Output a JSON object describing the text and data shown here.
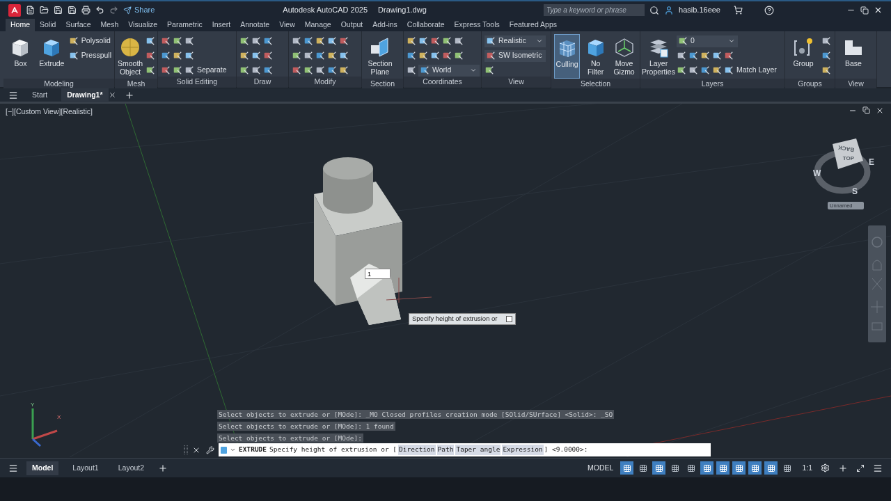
{
  "title_bar": {
    "share": "Share",
    "title": "Autodesk AutoCAD 2025",
    "file": "Drawing1.dwg",
    "search": {
      "placeholder": "Type a keyword or phrase"
    },
    "user": "hasib.16eee"
  },
  "ribbon_tabs": [
    {
      "label": "Home",
      "selected": true
    },
    {
      "label": "Solid",
      "selected": false
    },
    {
      "label": "Surface",
      "selected": false
    },
    {
      "label": "Mesh",
      "selected": false
    },
    {
      "label": "Visualize",
      "selected": false
    },
    {
      "label": "Parametric",
      "selected": false
    },
    {
      "label": "Insert",
      "selected": false
    },
    {
      "label": "Annotate",
      "selected": false
    },
    {
      "label": "View",
      "selected": false
    },
    {
      "label": "Manage",
      "selected": false
    },
    {
      "label": "Output",
      "selected": false
    },
    {
      "label": "Add-ins",
      "selected": false
    },
    {
      "label": "Collaborate",
      "selected": false
    },
    {
      "label": "Express Tools",
      "selected": false
    },
    {
      "label": "Featured Apps",
      "selected": false
    }
  ],
  "ribbon_panels": [
    {
      "title": "Modeling",
      "large": [
        {
          "label": "Box",
          "selected": false
        },
        {
          "label": "Extrude",
          "selected": false
        }
      ],
      "rows": [
        [
          {
            "kind": "small",
            "label": "Polysolid"
          }
        ],
        [
          {
            "kind": "small",
            "label": "Presspull"
          }
        ]
      ]
    },
    {
      "title": "Mesh",
      "large": [
        {
          "label": "Smooth Object",
          "selected": false
        }
      ],
      "rows": [
        [
          {
            "kind": "icon"
          }
        ],
        [
          {
            "kind": "icon"
          }
        ],
        [
          {
            "kind": "icon"
          }
        ]
      ]
    },
    {
      "title": "Solid Editing",
      "rows": [
        [
          {
            "kind": "icon"
          },
          {
            "kind": "icon"
          },
          {
            "kind": "icon"
          }
        ],
        [
          {
            "kind": "icon"
          },
          {
            "kind": "icon"
          },
          {
            "kind": "icon"
          }
        ],
        [
          {
            "kind": "icon"
          },
          {
            "kind": "icon"
          },
          {
            "kind": "small",
            "label": "Separate"
          }
        ]
      ]
    },
    {
      "title": "Draw",
      "rows": [
        [
          {
            "kind": "icon"
          },
          {
            "kind": "icon"
          },
          {
            "kind": "icon"
          }
        ],
        [
          {
            "kind": "icon"
          },
          {
            "kind": "icon"
          },
          {
            "kind": "icon"
          }
        ],
        [
          {
            "kind": "icon"
          },
          {
            "kind": "icon"
          },
          {
            "kind": "icon"
          }
        ]
      ]
    },
    {
      "title": "Modify",
      "rows": [
        [
          {
            "kind": "icon"
          },
          {
            "kind": "icon"
          },
          {
            "kind": "icon"
          },
          {
            "kind": "icon"
          },
          {
            "kind": "icon"
          }
        ],
        [
          {
            "kind": "icon"
          },
          {
            "kind": "icon"
          },
          {
            "kind": "icon"
          },
          {
            "kind": "icon"
          },
          {
            "kind": "icon"
          }
        ],
        [
          {
            "kind": "icon"
          },
          {
            "kind": "icon"
          },
          {
            "kind": "icon"
          },
          {
            "kind": "icon"
          },
          {
            "kind": "icon"
          }
        ]
      ]
    },
    {
      "title": "Section",
      "large": [
        {
          "label": "Section Plane",
          "selected": false
        }
      ]
    },
    {
      "title": "Coordinates",
      "rows": [
        [
          {
            "kind": "icon"
          },
          {
            "kind": "icon"
          },
          {
            "kind": "icon"
          },
          {
            "kind": "icon"
          },
          {
            "kind": "icon"
          }
        ],
        [
          {
            "kind": "icon"
          },
          {
            "kind": "icon"
          },
          {
            "kind": "icon"
          },
          {
            "kind": "icon"
          },
          {
            "kind": "icon"
          }
        ],
        [
          {
            "kind": "icon"
          },
          {
            "kind": "dropdown",
            "label": "World"
          }
        ]
      ]
    },
    {
      "title": "View",
      "rows": [
        [
          {
            "kind": "dropdown",
            "label": "Realistic"
          }
        ],
        [
          {
            "kind": "dropdown",
            "label": "SW Isometric"
          }
        ],
        [
          {
            "kind": "icon"
          }
        ]
      ]
    },
    {
      "title": "Selection",
      "large": [
        {
          "label": "Culling",
          "selected": true
        },
        {
          "label": "No Filter",
          "selected": false
        },
        {
          "label": "Move Gizmo",
          "selected": false
        }
      ]
    },
    {
      "title": "Layers",
      "large": [
        {
          "label": "Layer Properties",
          "selected": false
        }
      ],
      "rows": [
        [
          {
            "kind": "dropdown",
            "label": "0"
          }
        ],
        [
          {
            "kind": "icon"
          },
          {
            "kind": "icon"
          },
          {
            "kind": "icon"
          },
          {
            "kind": "icon"
          },
          {
            "kind": "icon"
          }
        ],
        [
          {
            "kind": "icon"
          },
          {
            "kind": "icon"
          },
          {
            "kind": "icon"
          },
          {
            "kind": "icon"
          },
          {
            "kind": "small",
            "label": "Match Layer"
          }
        ]
      ]
    },
    {
      "title": "Groups",
      "large": [
        {
          "label": "Group",
          "selected": false
        }
      ],
      "rows": [
        [
          {
            "kind": "icon"
          }
        ],
        [
          {
            "kind": "icon"
          }
        ],
        [
          {
            "kind": "icon"
          }
        ]
      ]
    },
    {
      "title": "View",
      "large": [
        {
          "label": "Base",
          "selected": false
        }
      ]
    }
  ],
  "file_tabs": [
    {
      "label": "Start",
      "selected": false
    },
    {
      "label": "Drawing1*",
      "selected": true
    }
  ],
  "viewport": {
    "label": "[−][Custom View][Realistic]",
    "viewcube": {
      "faces": [
        "BACK",
        "TOP"
      ],
      "compass": [
        "W",
        "E",
        "S"
      ],
      "view_name": "Unnamed"
    },
    "ucs_labels": [
      "Y",
      "X"
    ],
    "dynamic_input": {
      "value": "1"
    },
    "tooltip": "Specify height of extrusion or"
  },
  "command_history": [
    "Select objects to extrude or [MOde]: _MO Closed profiles creation mode [SOlid/SUrface] <Solid>: _SO",
    "Select objects to extrude or [MOde]: 1 found",
    "Select objects to extrude or [MOde]:"
  ],
  "command_line": {
    "command": "EXTRUDE",
    "prompt": "Specify height of extrusion or [",
    "options": [
      "Direction",
      "Path",
      "Taper angle",
      "Expression"
    ],
    "suffix": "] <9.0000>:"
  },
  "layout_tabs": [
    {
      "label": "Model",
      "selected": true
    },
    {
      "label": "Layout1",
      "selected": false
    },
    {
      "label": "Layout2",
      "selected": false
    }
  ],
  "status_bar": {
    "space": "MODEL",
    "toggles": [
      {
        "on": true
      },
      {
        "on": false
      },
      {
        "on": true
      },
      {
        "on": false
      },
      {
        "on": false
      },
      {
        "on": true
      },
      {
        "on": true
      },
      {
        "on": true
      },
      {
        "on": true
      },
      {
        "on": true
      },
      {
        "on": false
      }
    ],
    "scale": "1:1"
  }
}
